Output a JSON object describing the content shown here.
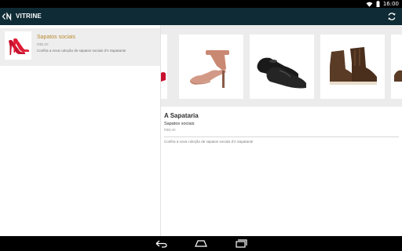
{
  "status_bar": {
    "time": "16:00"
  },
  "app_bar": {
    "title": "VITRINE"
  },
  "list": {
    "items": [
      {
        "title": "Sapatos sociais",
        "price": "R$0,00",
        "description": "Confira a nova coleção de sapatos sociais d'A Sapataria!"
      }
    ]
  },
  "detail": {
    "store_name": "A Sapataria",
    "collection_title": "Sapatos sociais",
    "price": "R$0,00",
    "description": "Confira a nova coleção de sapatos sociais d'A Sapataria!"
  },
  "gallery": {
    "photos": [
      {
        "icon": "red-heel-partial-image"
      },
      {
        "icon": "pink-heel-sandal-image"
      },
      {
        "icon": "black-dress-shoes-image"
      },
      {
        "icon": "brown-boots-image"
      },
      {
        "icon": "brown-shoe-partial-image"
      }
    ]
  },
  "colors": {
    "app_bar": "#0f2b35",
    "accent_gold": "#b88a30",
    "selected_row": "#eeeeee",
    "gallery_bg": "#ececec"
  }
}
